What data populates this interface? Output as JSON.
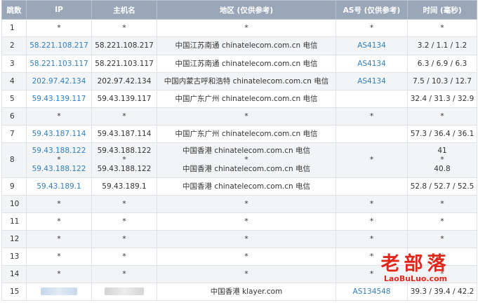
{
  "headers": {
    "hop": "跳数",
    "ip": "IP",
    "host": "主机名",
    "region": "地区 (仅供参考)",
    "as": "AS号 (仅供参考)",
    "time": "时间 (毫秒)"
  },
  "rows": [
    {
      "hop": "1",
      "ip": [
        "*"
      ],
      "host": [
        "*"
      ],
      "region": [
        "*"
      ],
      "as": [
        "*"
      ],
      "time": [
        "*"
      ]
    },
    {
      "hop": "2",
      "ip": [
        "58.221.108.217"
      ],
      "host": [
        "58.221.108.217"
      ],
      "region": [
        "中国江苏南通 chinatelecom.com.cn 电信"
      ],
      "as": [
        "AS4134"
      ],
      "time": [
        "3.2 / 1.1 / 1.2"
      ]
    },
    {
      "hop": "3",
      "ip": [
        "58.221.103.117"
      ],
      "host": [
        "58.221.103.117"
      ],
      "region": [
        "中国江苏南通 chinatelecom.com.cn 电信"
      ],
      "as": [
        "AS4134"
      ],
      "time": [
        "6.3 / 6.9 / 6.3"
      ]
    },
    {
      "hop": "4",
      "ip": [
        "202.97.42.134"
      ],
      "host": [
        "202.97.42.134"
      ],
      "region": [
        "中国内蒙古呼和浩特 chinatelecom.com.cn 电信"
      ],
      "as": [
        "AS4134"
      ],
      "time": [
        "7.5 / 10.3 / 12.7"
      ]
    },
    {
      "hop": "5",
      "ip": [
        "59.43.139.117"
      ],
      "host": [
        "59.43.139.117"
      ],
      "region": [
        "中国广东广州 chinatelecom.com.cn 电信"
      ],
      "as": [
        ""
      ],
      "time": [
        "32.4 / 31.3 / 32.9"
      ]
    },
    {
      "hop": "6",
      "ip": [
        "*"
      ],
      "host": [
        "*"
      ],
      "region": [
        "*"
      ],
      "as": [
        "*"
      ],
      "time": [
        "*"
      ]
    },
    {
      "hop": "7",
      "ip": [
        "59.43.187.114"
      ],
      "host": [
        "59.43.187.114"
      ],
      "region": [
        "中国广东广州 chinatelecom.com.cn 电信"
      ],
      "as": [
        ""
      ],
      "time": [
        "57.3 / 36.4 / 36.1"
      ]
    },
    {
      "hop": "8",
      "ip": [
        "59.43.188.122",
        "*",
        "59.43.188.122"
      ],
      "host": [
        "59.43.188.122",
        "*",
        "59.43.188.122"
      ],
      "region": [
        "中国香港 chinatelecom.com.cn 电信",
        "*",
        "中国香港 chinatelecom.com.cn 电信"
      ],
      "as": [
        "*"
      ],
      "time": [
        "41",
        "*",
        "40.8"
      ]
    },
    {
      "hop": "9",
      "ip": [
        "59.43.189.1"
      ],
      "host": [
        "59.43.189.1"
      ],
      "region": [
        "中国香港 chinatelecom.com.cn 电信"
      ],
      "as": [
        ""
      ],
      "time": [
        "52.8 / 52.7 / 52.5"
      ]
    },
    {
      "hop": "10",
      "ip": [
        "*"
      ],
      "host": [
        "*"
      ],
      "region": [
        "*"
      ],
      "as": [
        "*"
      ],
      "time": [
        "*"
      ]
    },
    {
      "hop": "11",
      "ip": [
        "*"
      ],
      "host": [
        "*"
      ],
      "region": [
        "*"
      ],
      "as": [
        "*"
      ],
      "time": [
        "*"
      ]
    },
    {
      "hop": "12",
      "ip": [
        "*"
      ],
      "host": [
        "*"
      ],
      "region": [
        "*"
      ],
      "as": [
        "*"
      ],
      "time": [
        "*"
      ]
    },
    {
      "hop": "13",
      "ip": [
        "*"
      ],
      "host": [
        "*"
      ],
      "region": [
        "*"
      ],
      "as": [
        "*"
      ],
      "time": [
        "*"
      ]
    },
    {
      "hop": "14",
      "ip": [
        "*"
      ],
      "host": [
        "*"
      ],
      "region": [
        "*"
      ],
      "as": [
        "*"
      ],
      "time": [
        "*"
      ]
    },
    {
      "hop": "15",
      "ip": [
        "[redacted]"
      ],
      "host": [
        "[redacted]"
      ],
      "region": [
        "中国香港 klayer.com"
      ],
      "as": [
        "AS134548"
      ],
      "time": [
        "39.3 / 39.4 / 42.2"
      ]
    }
  ],
  "watermark": {
    "text_cn": "老部落",
    "text_en": "LaoBuLuo.com"
  },
  "colors": {
    "header_bg": "#9aa7b8",
    "link": "#2f7fc1",
    "row_alt": "#f3f4f6",
    "border": "#dfe3e8",
    "watermark": "#e1261c"
  }
}
